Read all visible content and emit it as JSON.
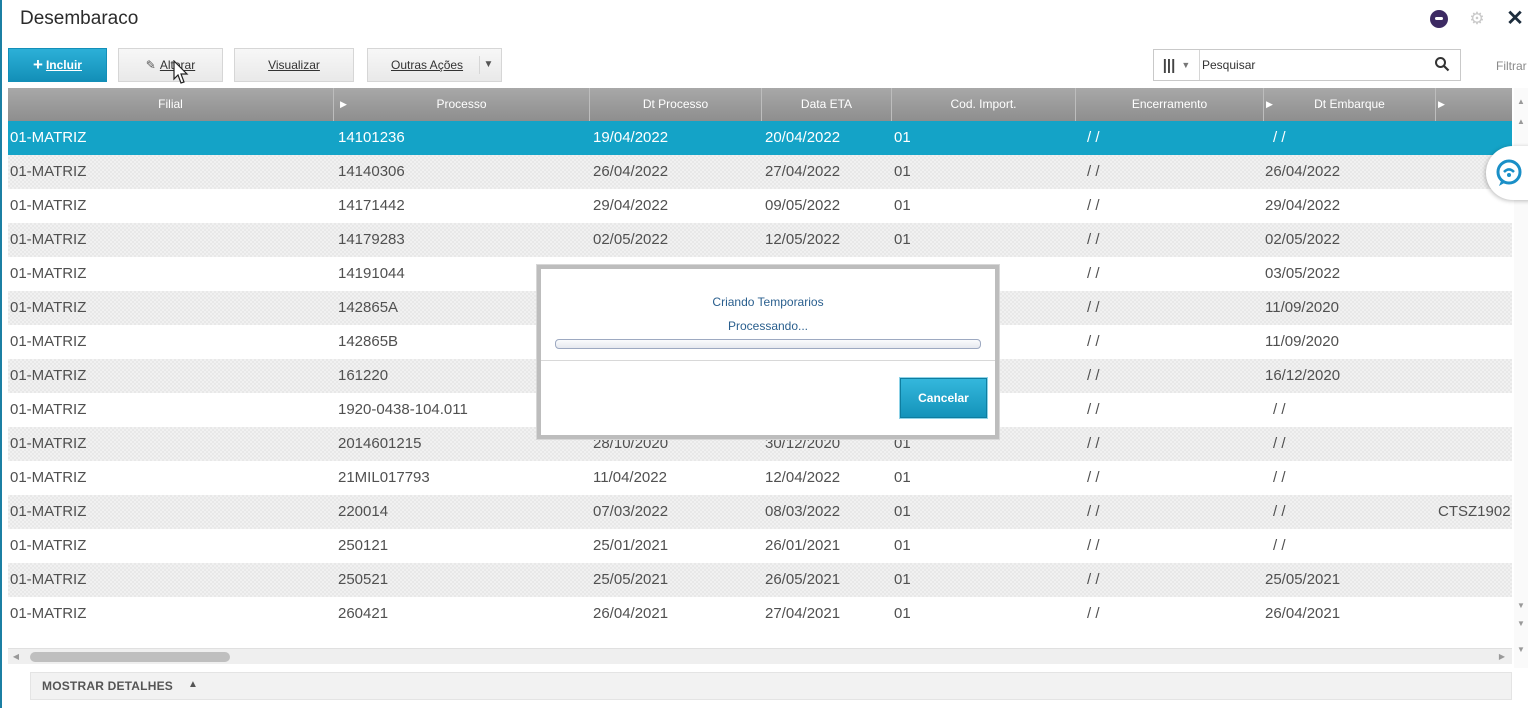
{
  "window": {
    "title": "Desembaraco"
  },
  "toolbar": {
    "incluir_label": "Incluir",
    "alterar_label": "Alterar",
    "visualizar_label": "Visualizar",
    "outras_label": "Outras Ações"
  },
  "search": {
    "placeholder": "Pesquisar",
    "filter_label": "Filtrar"
  },
  "grid": {
    "columns": [
      "Filial",
      "Processo",
      "Dt Processo",
      "Data ETA",
      "Cod. Import.",
      "Encerramento",
      "Dt Embarque"
    ],
    "rows": [
      [
        "01-MATRIZ",
        "14101236",
        "19/04/2022",
        "20/04/2022",
        "01",
        "/ /",
        "/ /",
        ""
      ],
      [
        "01-MATRIZ",
        "14140306",
        "26/04/2022",
        "27/04/2022",
        "01",
        "/ /",
        "26/04/2022",
        ""
      ],
      [
        "01-MATRIZ",
        "14171442",
        "29/04/2022",
        "09/05/2022",
        "01",
        "/ /",
        "29/04/2022",
        ""
      ],
      [
        "01-MATRIZ",
        "14179283",
        "02/05/2022",
        "12/05/2022",
        "01",
        "/ /",
        "02/05/2022",
        ""
      ],
      [
        "01-MATRIZ",
        "14191044",
        "",
        "",
        "",
        "/ /",
        "03/05/2022",
        ""
      ],
      [
        "01-MATRIZ",
        "142865A",
        "",
        "",
        "",
        "/ /",
        "11/09/2020",
        ""
      ],
      [
        "01-MATRIZ",
        "142865B",
        "",
        "",
        "",
        "/ /",
        "11/09/2020",
        ""
      ],
      [
        "01-MATRIZ",
        "161220",
        "",
        "",
        "",
        "/ /",
        "16/12/2020",
        ""
      ],
      [
        "01-MATRIZ",
        "1920-0438-104.011",
        "",
        "",
        "",
        "/ /",
        "/ /",
        ""
      ],
      [
        "01-MATRIZ",
        "2014601215",
        "28/10/2020",
        "30/12/2020",
        "01",
        "/ /",
        "/ /",
        ""
      ],
      [
        "01-MATRIZ",
        "21MIL017793",
        "11/04/2022",
        "12/04/2022",
        "01",
        "/ /",
        "/ /",
        ""
      ],
      [
        "01-MATRIZ",
        "220014",
        "07/03/2022",
        "08/03/2022",
        "01",
        "/ /",
        "/ /",
        "CTSZ1902"
      ],
      [
        "01-MATRIZ",
        "250121",
        "25/01/2021",
        "26/01/2021",
        "01",
        "/ /",
        "/ /",
        ""
      ],
      [
        "01-MATRIZ",
        "250521",
        "25/05/2021",
        "26/05/2021",
        "01",
        "/ /",
        "25/05/2021",
        ""
      ],
      [
        "01-MATRIZ",
        "260421",
        "26/04/2021",
        "27/04/2021",
        "01",
        "/ /",
        "26/04/2021",
        ""
      ]
    ],
    "selected_row": 0
  },
  "details": {
    "label": "MOSTRAR DETALHES"
  },
  "modal": {
    "title": "Criando Temporarios",
    "message": "Processando...",
    "progress": 0,
    "cancel_label": "Cancelar"
  },
  "icons": {
    "incluir": "plus-icon",
    "alterar": "pencil-icon",
    "outras_acoes": "chevron-down-icon",
    "columns": "columns-icon",
    "search": "search-icon",
    "app": "app-icon",
    "settings": "gear-icon",
    "close": "close-icon",
    "help": "chat-help-icon"
  },
  "colors": {
    "accent": "#14a3c7",
    "header": "#9b9b9b",
    "modal_text": "#2a5f8e"
  }
}
